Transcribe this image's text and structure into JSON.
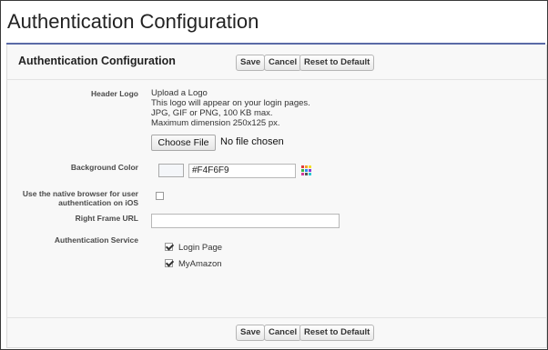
{
  "page_title": "Authentication Configuration",
  "section_title": "Authentication Configuration",
  "buttons": {
    "save": "Save",
    "cancel": "Cancel",
    "reset": "Reset to Default"
  },
  "header_logo": {
    "label": "Header Logo",
    "info_title": "Upload a Logo",
    "info_lines": [
      "This logo will appear on your login pages.",
      "JPG, GIF or PNG, 100 KB max.",
      "Maximum dimension 250x125 px."
    ],
    "choose_file_label": "Choose File",
    "file_status": "No file chosen"
  },
  "background_color": {
    "label": "Background Color",
    "value": "#F4F6F9",
    "swatch_color": "#F4F6F9"
  },
  "native_browser": {
    "label_line1": "Use the native browser for user",
    "label_line2": "authentication on iOS",
    "checked": false
  },
  "right_frame_url": {
    "label": "Right Frame URL",
    "value": ""
  },
  "authentication_service": {
    "label": "Authentication Service",
    "options": [
      {
        "label": "Login Page",
        "checked": true
      },
      {
        "label": "MyAmazon",
        "checked": true
      }
    ]
  },
  "colors": {
    "title_rule": "#5a6aa6",
    "panel_bg": "#f8f8f8"
  }
}
